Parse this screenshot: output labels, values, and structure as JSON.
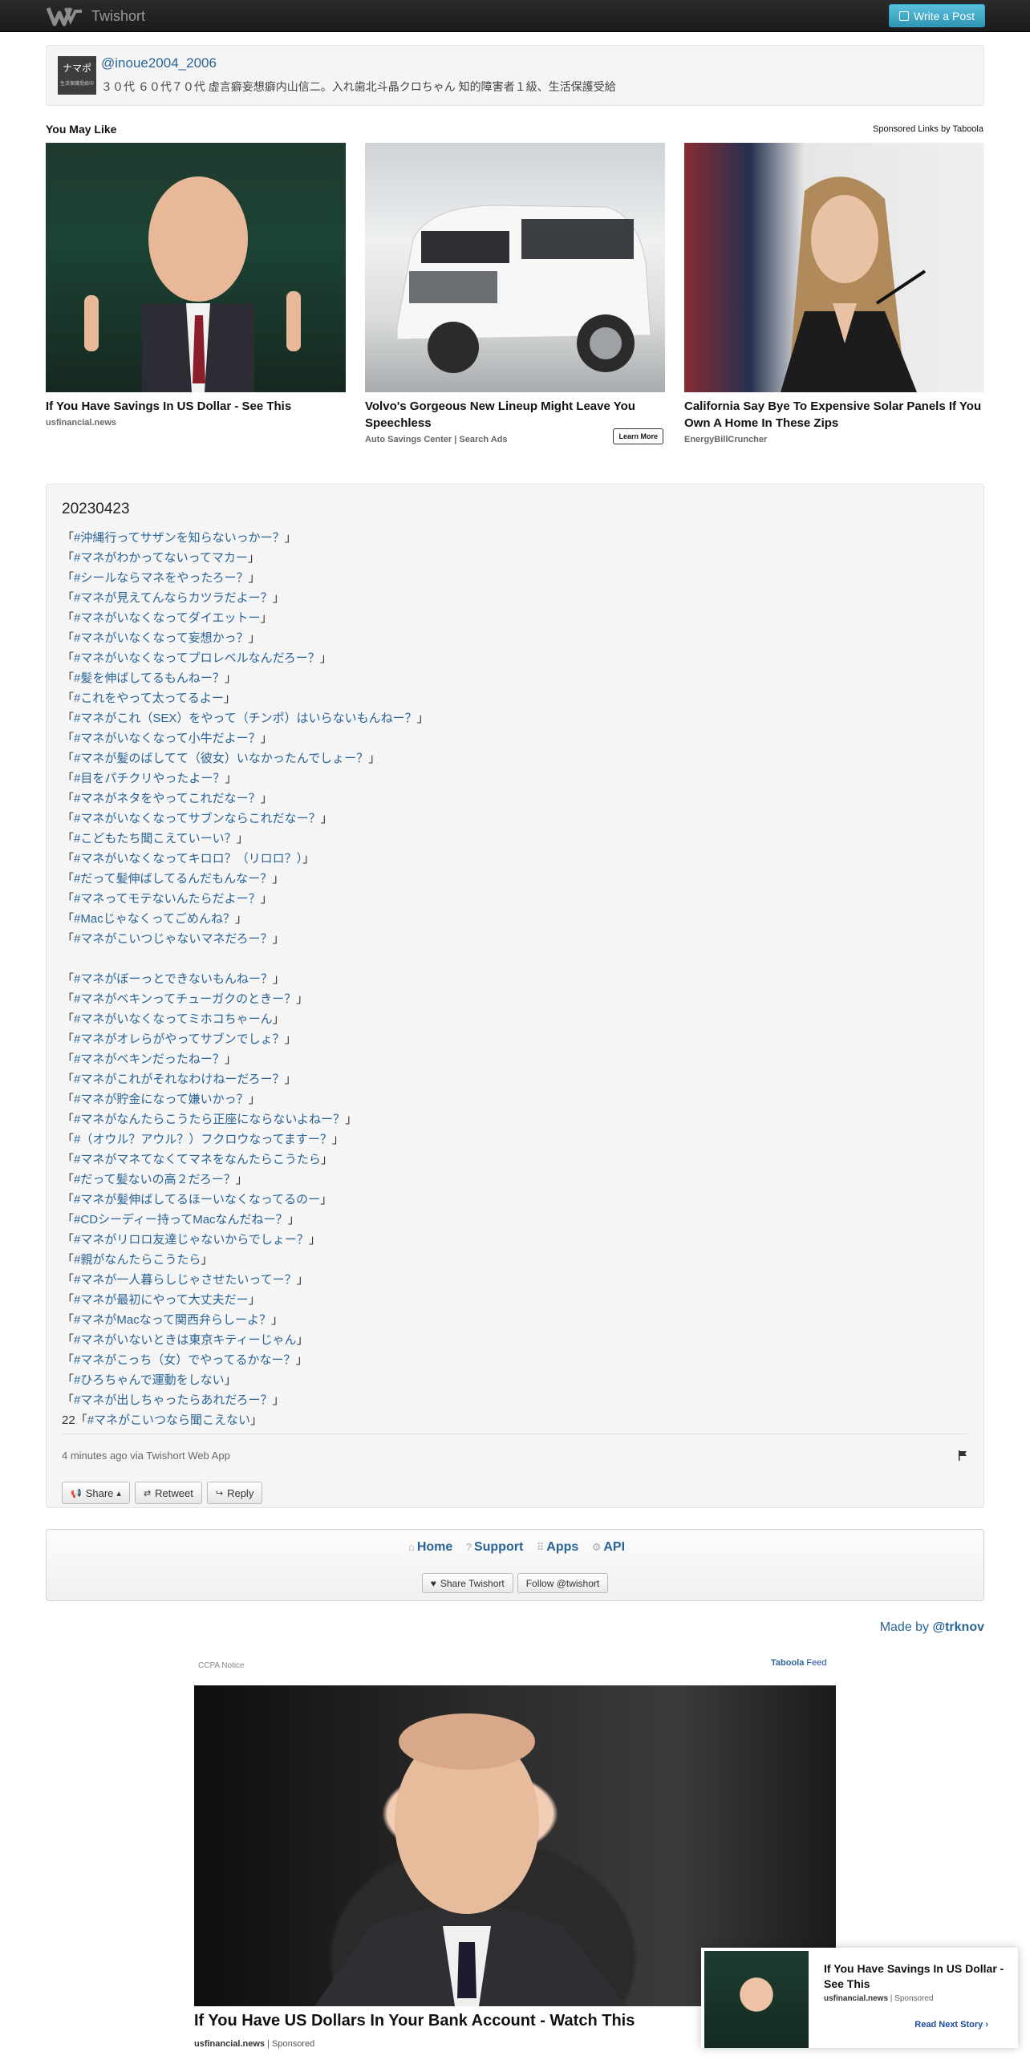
{
  "navbar": {
    "brand": "Twishort",
    "write_label": "Write a Post"
  },
  "profile": {
    "avatar_text": "ナマポ",
    "avatar_sub": "生活保護受給中",
    "handle": "@inoue2004_2006",
    "bio": "３０代 ６０代７０代 虚言癖妄想癖内山信二。入れ歯北斗晶クロちゃん 知的障害者１級、生活保護受給"
  },
  "you_may_like": {
    "title": "You May Like",
    "sponsor": "Sponsored Links by Taboola",
    "cards": [
      {
        "title": "If You Have Savings In US Dollar - See This",
        "source": "usfinancial.news"
      },
      {
        "title": "Volvo's Gorgeous New Lineup Might Leave You Speechless",
        "source": "Auto Savings Center | Search Ads",
        "cta": "Learn More"
      },
      {
        "title": "California Say Bye To Expensive Solar Panels If You Own A Home In These Zips",
        "source": "EnergyBillCruncher"
      }
    ]
  },
  "post": {
    "date": "20230423",
    "lines": [
      "「#沖縄行ってサザンを知らないっかー？」",
      "「#マネがわかってないってマカー」",
      "「#シールならマネをやったろー？」",
      "「#マネが見えてんならカツラだよー？」",
      "「#マネがいなくなってダイエットー」",
      "「#マネがいなくなって妄想かっ？」",
      "「#マネがいなくなってプロレベルなんだろー？」",
      "「#髪を伸ばしてるもんねー？」",
      "「#これをやって太ってるよー」",
      "「#マネがこれ（SEX）をやって（チンポ）はいらないもんねー？」",
      "「#マネがいなくなって小牛だよー？」",
      "「#マネが髪のばしてて（彼女）いなかったんでしょー？」",
      "「#目をパチクリやったよー？」",
      "「#マネがネタをやってこれだなー？」",
      "「#マネがいなくなってサブンならこれだなー？」",
      "「#こどもたち聞こえていーい？」",
      "「#マネがいなくなってキロロ？（リロロ？）」",
      "「#だって髪伸ばしてるんだもんなー？」",
      "「#マネってモテないんたらだよー？」",
      "「#Macじゃなくってごめんね？」",
      "「#マネがこいつじゃないマネだろー？」",
      "",
      "「#マネがぼーっとできないもんねー？」",
      "「#マネがベキンってチューガクのときー？」",
      "「#マネがいなくなってミホコちゃーん」",
      "「#マネがオレらがやってサブンでしょ？」",
      "「#マネがベキンだったねー？」",
      "「#マネがこれがそれなわけねーだろー？」",
      "「#マネが貯金になって嫌いかっ？」",
      "「#マネがなんたらこうたら正座にならないよねー？」",
      "「#（オウル？アウル？）フクロウなってますー？」",
      "「#マネがマネてなくてマネをなんたらこうたら」",
      "「#だって髪ないの高２だろー？」",
      "「#マネが髪伸ばしてるほーいなくなってるのー」",
      "「#CDシーディー持ってMacなんだねー？」",
      "「#マネがリロロ友達じゃないからでしょー？」",
      "「#親がなんたらこうたら」",
      "「#マネが一人暮らしじゃさせたいってー？」",
      "「#マネが最初にやって大丈夫だー」",
      "「#マネがMacなって関西弁らしーよ？」",
      "「#マネがいないときは東京キティーじゃん」",
      "「#マネがこっち（女）でやってるかなー？」",
      "「#ひろちゃんで運動をしない」",
      "「#マネが出しちゃったらあれだろー？」",
      "22「#マネがこいつなら聞こえない」"
    ],
    "meta": "4 minutes ago via Twishort Web App",
    "buttons": {
      "share": "Share",
      "retweet": "Retweet",
      "reply": "Reply"
    }
  },
  "footer": {
    "links": {
      "home": "Home",
      "support": "Support",
      "apps": "Apps",
      "api": "API"
    },
    "share_btn": "Share Twishort",
    "follow_btn": "Follow @twishort"
  },
  "madeby": {
    "prefix": "Made by ",
    "user": "@trknov"
  },
  "feed": {
    "ccpa": "CCPA Notice",
    "brand": "Taboola",
    "brand_suffix": " Feed",
    "title": "If You Have US Dollars In Your Bank Account - Watch This",
    "source": "usfinancial.news",
    "sponsored": " | Sponsored"
  },
  "popup": {
    "title": "If You Have Savings In US Dollar - See This",
    "source": "usfinancial.news",
    "sponsored": " | Sponsored",
    "next": "Read Next Story ›"
  },
  "colors": {
    "link": "#2a6496",
    "accent": "#5bc0de",
    "navbar": "#1f1f1f"
  }
}
